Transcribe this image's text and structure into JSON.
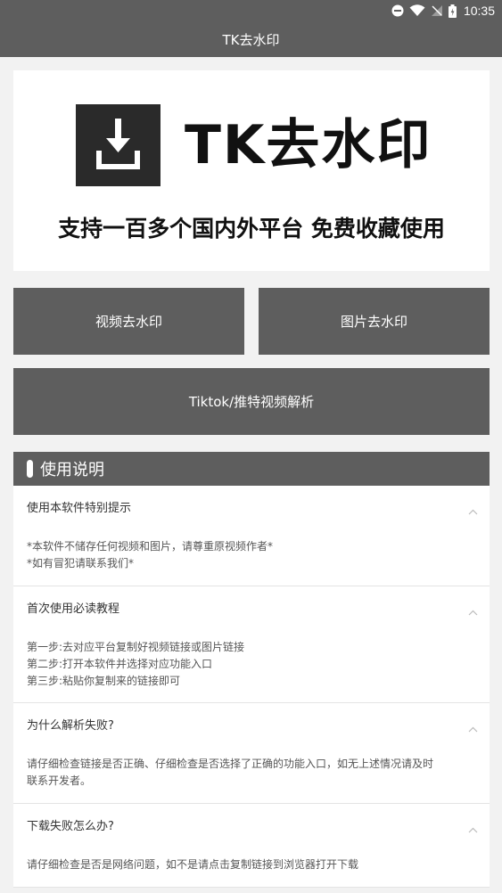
{
  "status_bar": {
    "time": "10:35",
    "icons": [
      "do-not-disturb-icon",
      "wifi-icon",
      "signal-icon",
      "battery-icon"
    ]
  },
  "app_bar": {
    "title": "TK去水印"
  },
  "banner": {
    "logo_icon": "download-icon",
    "logo_text": "TK去水印",
    "slogan": "支持一百多个国内外平台 免费收藏使用"
  },
  "buttons": {
    "video": "视频去水印",
    "image": "图片去水印",
    "tiktok": "Tiktok/推特视频解析"
  },
  "instructions": {
    "title": "使用说明",
    "items": [
      {
        "question": "使用本软件特别提示",
        "answer": [
          "*本软件不储存任何视频和图片，请尊重原视频作者*",
          "*如有冒犯请联系我们*"
        ]
      },
      {
        "question": "首次使用必读教程",
        "answer": [
          "第一步:去对应平台复制好视频链接或图片链接",
          "第二步:打开本软件并选择对应功能入口",
          "第三步:粘贴你复制来的链接即可"
        ]
      },
      {
        "question": "为什么解析失败?",
        "answer": [
          "请仔细检查链接是否正确、仔细检查是否选择了正确的功能入口，如无上述情况请及时",
          "联系开发者。"
        ]
      },
      {
        "question": "下载失败怎么办?",
        "answer": [
          "请仔细检查是否是网络问题，如不是请点击复制链接到浏览器打开下载"
        ]
      }
    ]
  },
  "colors": {
    "bar": "#5e5e5e",
    "background": "#f2f2f2",
    "card": "#ffffff"
  }
}
